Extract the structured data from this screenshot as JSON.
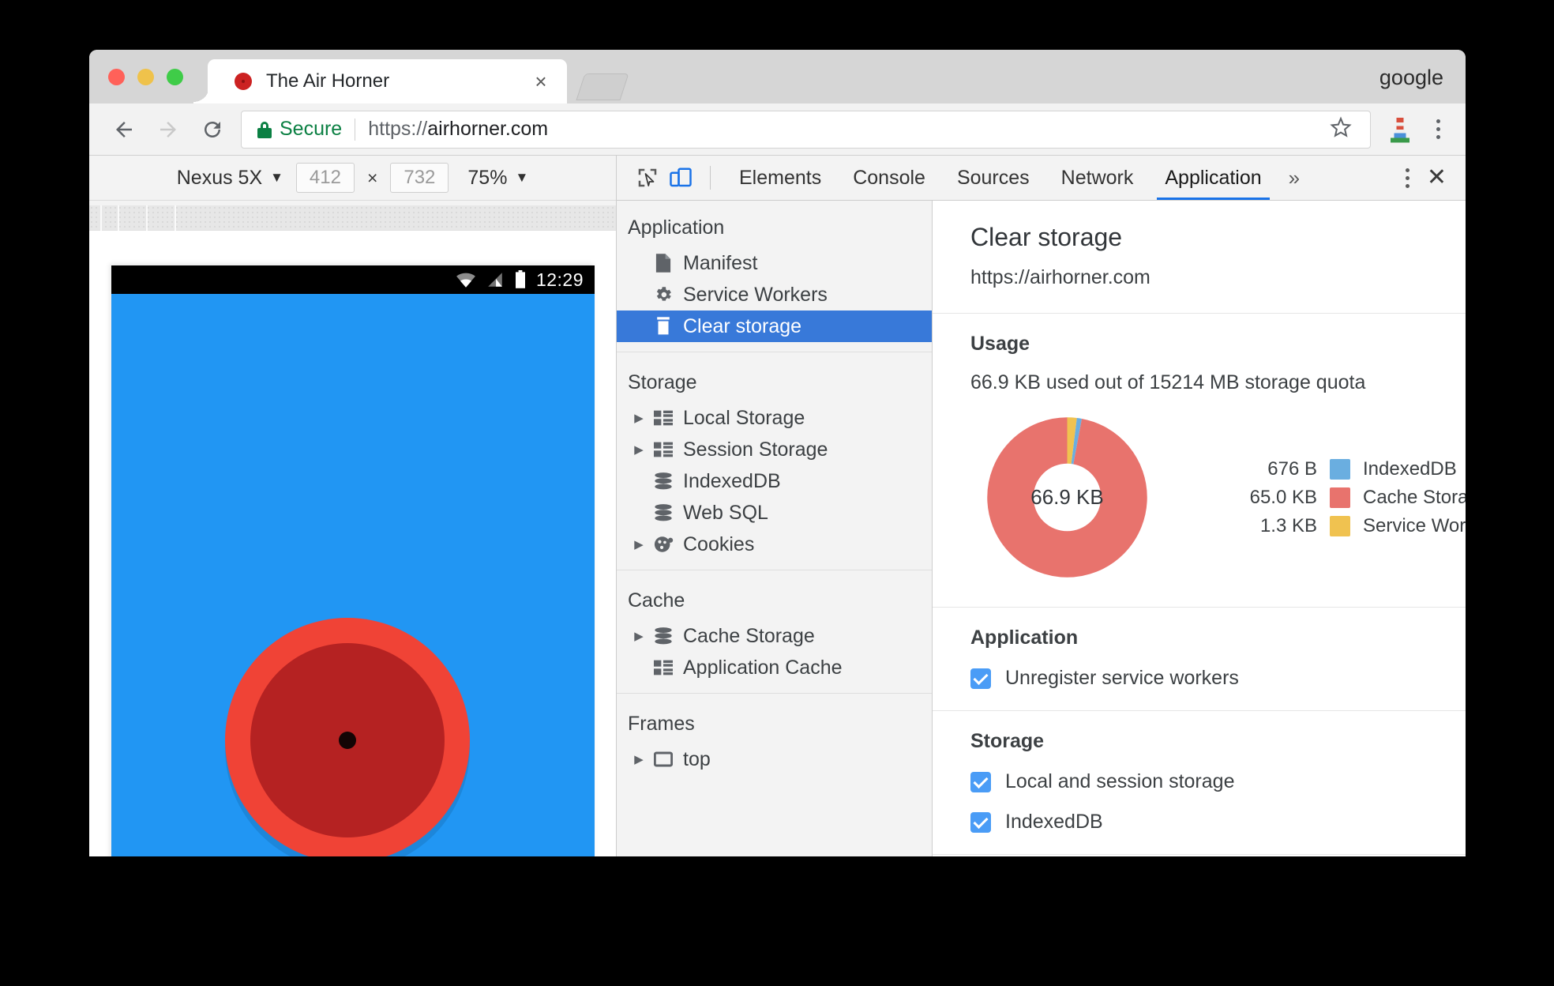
{
  "window": {
    "profile_label": "google",
    "tab": {
      "title": "The Air Horner",
      "close": "×",
      "favicon": "airhorner-favicon"
    },
    "newtab_label": ""
  },
  "omnibox": {
    "secure_label": "Secure",
    "url_scheme": "https://",
    "url_host": "airhorner.com",
    "star": "☆"
  },
  "device_toolbar": {
    "device": "Nexus 5X",
    "caret": "▼",
    "width": "412",
    "height": "732",
    "times": "×",
    "zoom": "75%"
  },
  "phone": {
    "clock": "12:29"
  },
  "devtools": {
    "tabs": [
      {
        "label": "Elements",
        "active": false
      },
      {
        "label": "Console",
        "active": false
      },
      {
        "label": "Sources",
        "active": false
      },
      {
        "label": "Network",
        "active": false
      },
      {
        "label": "Application",
        "active": true
      }
    ],
    "more": "»",
    "close": "✕",
    "sidebar": {
      "groups": [
        {
          "title": "Application",
          "items": [
            {
              "label": "Manifest",
              "icon": "document-icon",
              "twisty": false,
              "selected": false
            },
            {
              "label": "Service Workers",
              "icon": "gear-icon",
              "twisty": false,
              "selected": false
            },
            {
              "label": "Clear storage",
              "icon": "trash-icon",
              "twisty": false,
              "selected": true
            }
          ]
        },
        {
          "title": "Storage",
          "items": [
            {
              "label": "Local Storage",
              "icon": "table-icon",
              "twisty": true,
              "selected": false
            },
            {
              "label": "Session Storage",
              "icon": "table-icon",
              "twisty": true,
              "selected": false
            },
            {
              "label": "IndexedDB",
              "icon": "database-icon",
              "twisty": false,
              "selected": false
            },
            {
              "label": "Web SQL",
              "icon": "database-icon",
              "twisty": false,
              "selected": false
            },
            {
              "label": "Cookies",
              "icon": "cookie-icon",
              "twisty": true,
              "selected": false
            }
          ]
        },
        {
          "title": "Cache",
          "items": [
            {
              "label": "Cache Storage",
              "icon": "database-icon",
              "twisty": true,
              "selected": false
            },
            {
              "label": "Application Cache",
              "icon": "table-icon",
              "twisty": false,
              "selected": false
            }
          ]
        },
        {
          "title": "Frames",
          "items": [
            {
              "label": "top",
              "icon": "frame-icon",
              "twisty": true,
              "selected": false
            }
          ]
        }
      ]
    },
    "panel": {
      "title": "Clear storage",
      "origin": "https://airhorner.com",
      "usage": {
        "heading": "Usage",
        "summary": "66.9 KB used out of 15214 MB storage quota",
        "center_label": "66.9 KB"
      },
      "application": {
        "heading": "Application",
        "checks": [
          {
            "label": "Unregister service workers",
            "checked": true
          }
        ]
      },
      "storage": {
        "heading": "Storage",
        "checks": [
          {
            "label": "Local and session storage",
            "checked": true
          },
          {
            "label": "IndexedDB",
            "checked": true
          }
        ]
      }
    }
  },
  "colors": {
    "accent": "#1a73e8",
    "selection": "#3879d9",
    "secure_green": "#0b8043",
    "indexeddb": "#6aaee0",
    "cache_storage": "#e8736d",
    "service_workers": "#f0c250",
    "checkbox": "#4a9cf6"
  },
  "chart_data": {
    "type": "pie",
    "title": "Usage",
    "subtitle": "66.9 KB used out of 15214 MB storage quota",
    "center_label": "66.9 KB",
    "total": "66.9 KB",
    "donut": true,
    "inner_radius_ratio": 0.6,
    "legend_position": "right",
    "categories": [
      "IndexedDB",
      "Cache Storage",
      "Service Workers"
    ],
    "value_labels": [
      "676 B",
      "65.0 KB",
      "1.3 KB"
    ],
    "values_bytes": [
      676,
      66560,
      1331
    ],
    "values_pct": [
      0.99,
      97.07,
      1.94
    ],
    "colors": [
      "#6aaee0",
      "#e8736d",
      "#f0c250"
    ],
    "slices": [
      {
        "name": "IndexedDB",
        "label": "676 B",
        "bytes": 676,
        "pct": 0.99,
        "color": "#6aaee0"
      },
      {
        "name": "Cache Storage",
        "label": "65.0 KB",
        "bytes": 66560,
        "pct": 97.07,
        "color": "#e8736d"
      },
      {
        "name": "Service Workers",
        "label": "1.3 KB",
        "bytes": 1331,
        "pct": 1.94,
        "color": "#f0c250"
      }
    ]
  }
}
